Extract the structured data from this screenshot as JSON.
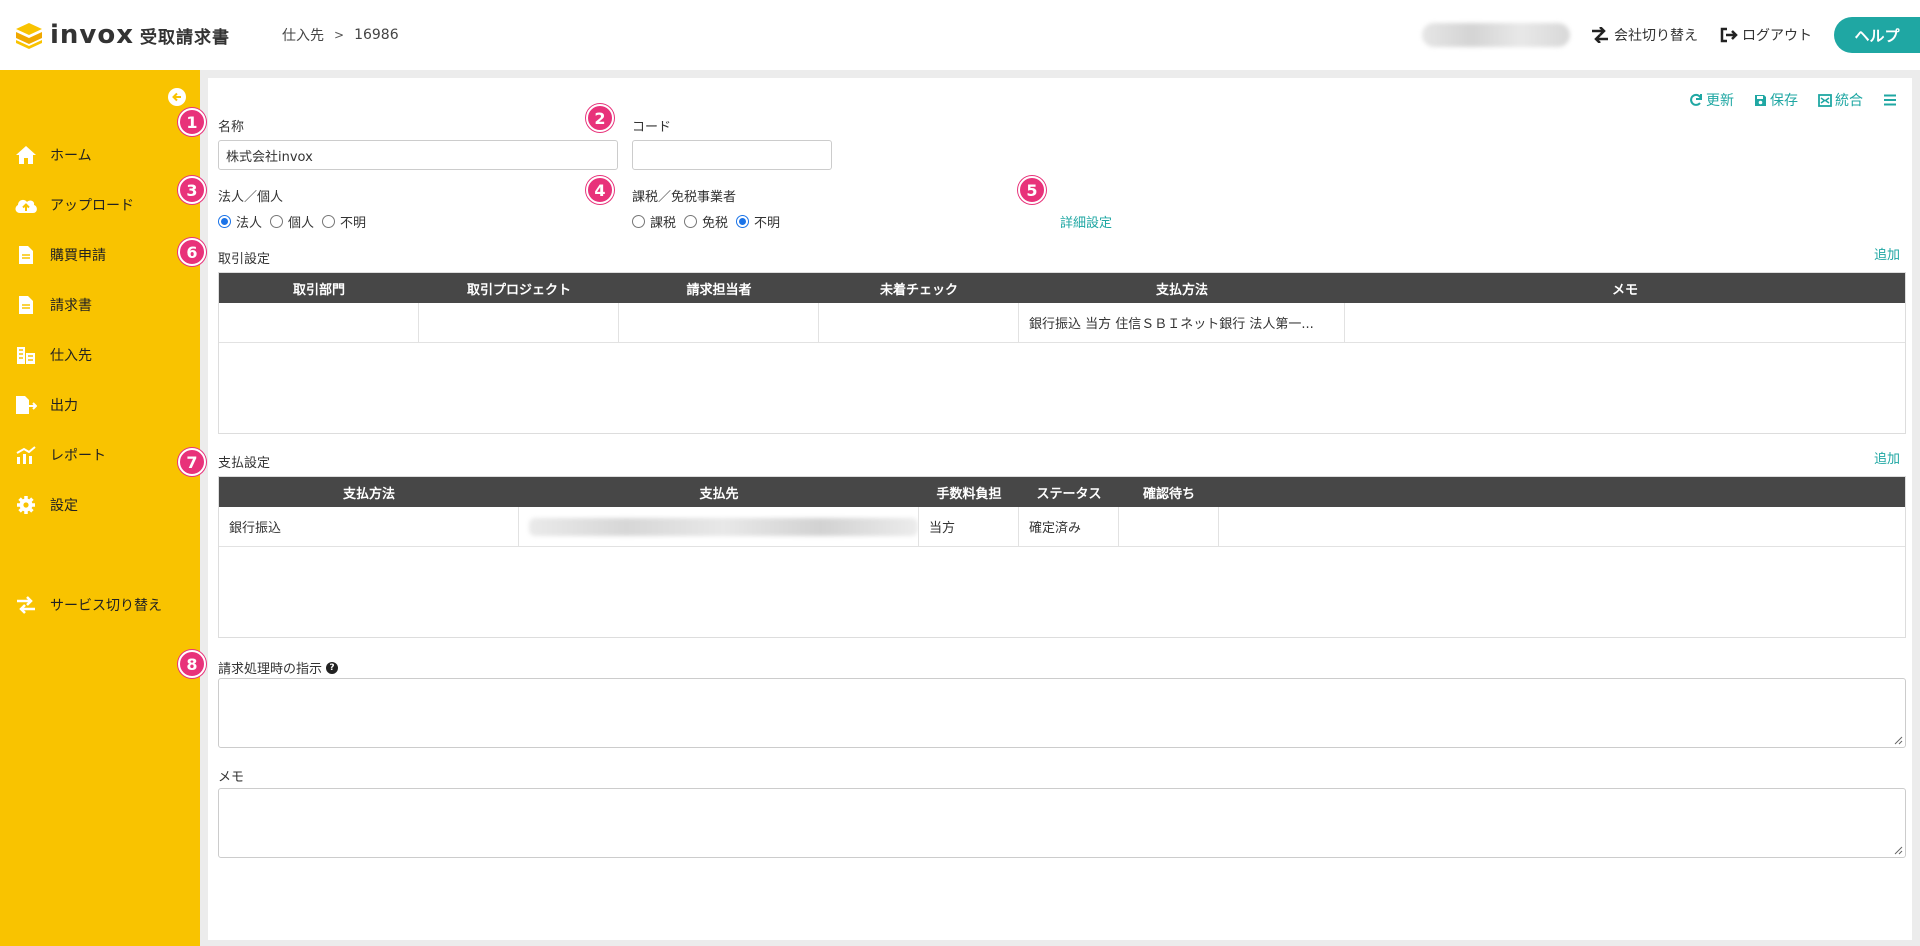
{
  "brand": {
    "name": "invox",
    "product": "受取請求書"
  },
  "breadcrumb": {
    "section": "仕入先",
    "id": "16986"
  },
  "header": {
    "switch_company": "会社切り替え",
    "logout": "ログアウト",
    "help": "ヘルプ"
  },
  "sidebar": {
    "items": [
      {
        "label": "ホーム",
        "icon": "home-icon"
      },
      {
        "label": "アップロード",
        "icon": "cloud-upload-icon"
      },
      {
        "label": "購買申請",
        "icon": "document-icon"
      },
      {
        "label": "請求書",
        "icon": "invoice-icon"
      },
      {
        "label": "仕入先",
        "icon": "building-icon"
      },
      {
        "label": "出力",
        "icon": "file-export-icon"
      },
      {
        "label": "レポート",
        "icon": "chart-icon"
      },
      {
        "label": "設定",
        "icon": "gear-icon"
      }
    ],
    "service_switch": "サービス切り替え"
  },
  "toolbar": {
    "refresh": "更新",
    "save": "保存",
    "merge": "統合"
  },
  "badges": [
    "1",
    "2",
    "3",
    "4",
    "5",
    "6",
    "7",
    "8"
  ],
  "form": {
    "name_label": "名称",
    "name_value": "株式会社invox",
    "code_label": "コード",
    "code_value": "",
    "entity_label": "法人／個人",
    "entity_options": [
      "法人",
      "個人",
      "不明"
    ],
    "entity_selected": "法人",
    "tax_label": "課税／免税事業者",
    "tax_options": [
      "課税",
      "免税",
      "不明"
    ],
    "tax_selected": "不明",
    "detail_link": "詳細設定"
  },
  "trade_settings": {
    "title": "取引設定",
    "add": "追加",
    "columns": [
      "取引部門",
      "取引プロジェクト",
      "請求担当者",
      "未着チェック",
      "支払方法",
      "メモ"
    ],
    "rows": [
      [
        "",
        "",
        "",
        "",
        "銀行振込 当方 住信ＳＢＩネット銀行 法人第一...",
        ""
      ]
    ]
  },
  "payment_settings": {
    "title": "支払設定",
    "add": "追加",
    "columns": [
      "支払方法",
      "支払先",
      "手数料負担",
      "ステータス",
      "確認待ち"
    ],
    "rows": [
      [
        "銀行振込",
        "",
        "当方",
        "確定済み",
        ""
      ]
    ]
  },
  "instruction": {
    "label": "請求処理時の指示",
    "value": ""
  },
  "memo": {
    "label": "メモ",
    "value": ""
  }
}
